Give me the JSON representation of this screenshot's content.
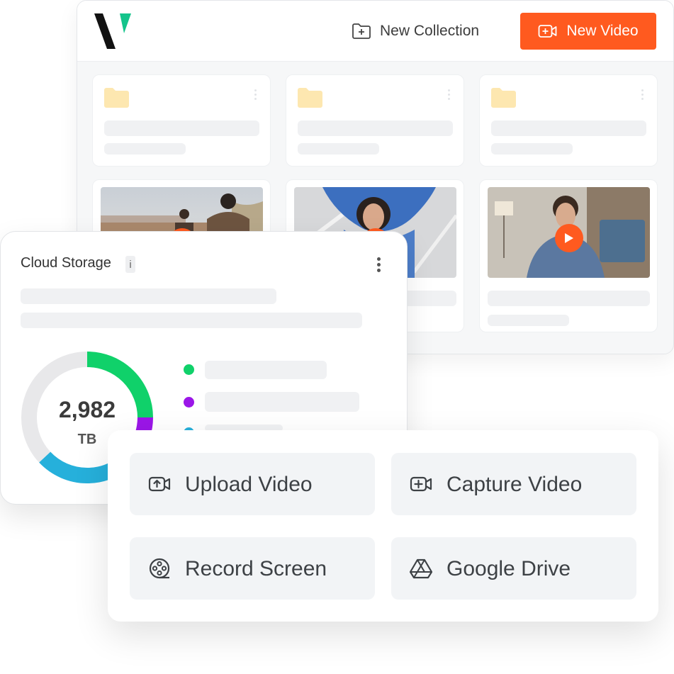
{
  "header": {
    "new_collection_label": "New Collection",
    "new_video_label": "New Video",
    "accent_color": "#ff5a1f",
    "logo_icon": "brand-logo"
  },
  "folders": [
    {
      "icon": "folder-icon"
    },
    {
      "icon": "folder-icon"
    },
    {
      "icon": "folder-icon"
    }
  ],
  "videos": [
    {
      "icon": "play-icon"
    },
    {
      "icon": "play-icon"
    },
    {
      "icon": "play-icon"
    }
  ],
  "storage": {
    "title": "Cloud Storage",
    "info_badge": "i",
    "total_value": "2,982",
    "unit": "TB",
    "segments": [
      {
        "color": "#10d16a",
        "fraction": 0.25
      },
      {
        "color": "#9b16e8",
        "fraction": 0.05
      },
      {
        "color": "#26b0db",
        "fraction": 0.33
      },
      {
        "color": "#e8e8ea",
        "fraction": 0.37
      }
    ],
    "legend_colors": [
      "#10d16a",
      "#9b16e8",
      "#26b0db"
    ]
  },
  "actions": {
    "upload_video": "Upload Video",
    "capture_video": "Capture Video",
    "record_screen": "Record Screen",
    "google_drive": "Google Drive"
  }
}
